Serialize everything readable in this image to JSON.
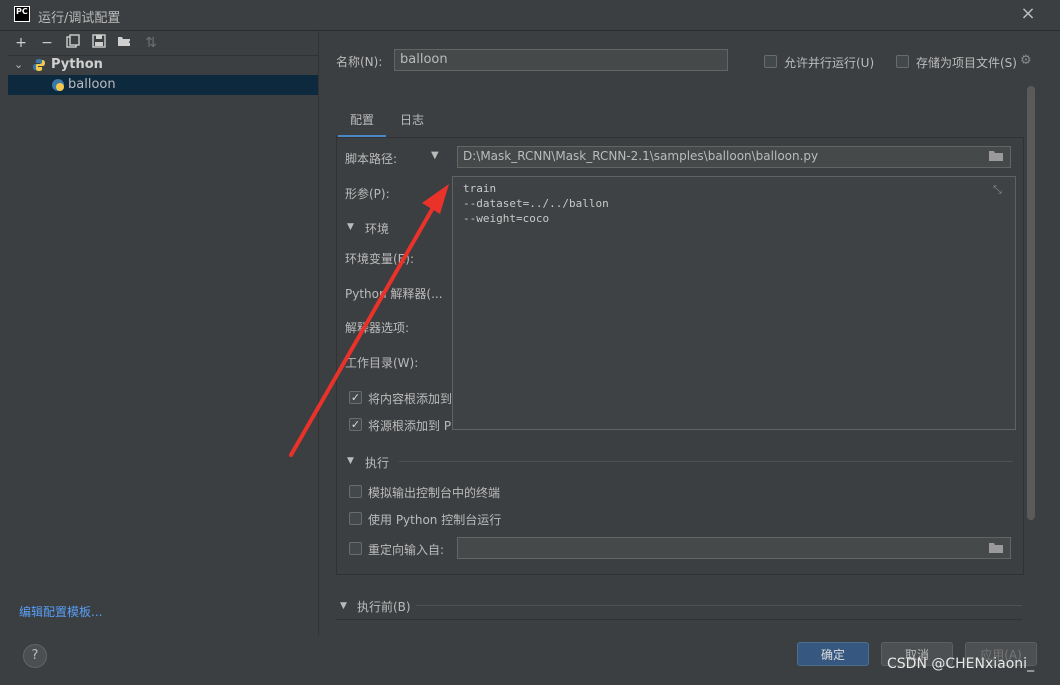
{
  "window": {
    "app_icon": "PC",
    "title": "运行/调试配置"
  },
  "tree": {
    "group": "Python",
    "item": "balloon"
  },
  "edit_templates": "编辑配置模板...",
  "form": {
    "name_label": "名称(N):",
    "name_value": "balloon",
    "allow_parallel": "允许并行运行(U)",
    "store_as_project": "存储为项目文件(S)",
    "tabs": [
      "配置",
      "日志"
    ],
    "script_path_label": "脚本路径:",
    "script_path_value": "D:\\Mask_RCNN\\Mask_RCNN-2.1\\samples\\balloon\\balloon.py",
    "params_label": "形参(P):",
    "params_lines": [
      "train",
      "--dataset=../../ballon",
      "--weight=coco"
    ],
    "env_section": "环境",
    "env_vars_label": "环境变量(E):",
    "interpreter_label": "Python 解释器(...",
    "interpreter_options_label": "解释器选项:",
    "workdir_label": "工作目录(W):",
    "add_content_roots": "将内容根添加到",
    "add_source_roots": "将源根添加到 P",
    "exec_section": "执行",
    "emulate_terminal": "模拟输出控制台中的终端",
    "use_python_console": "使用 Python 控制台运行",
    "redirect_input": "重定向输入自:",
    "before_launch": "执行前(B)"
  },
  "buttons": {
    "help": "?",
    "ok": "确定",
    "cancel": "取消",
    "apply": "应用(A)"
  },
  "watermark": "CSDN @CHENxiaoni_",
  "colors": {
    "arrow": "#e8322a",
    "accent": "#4a88c7"
  }
}
